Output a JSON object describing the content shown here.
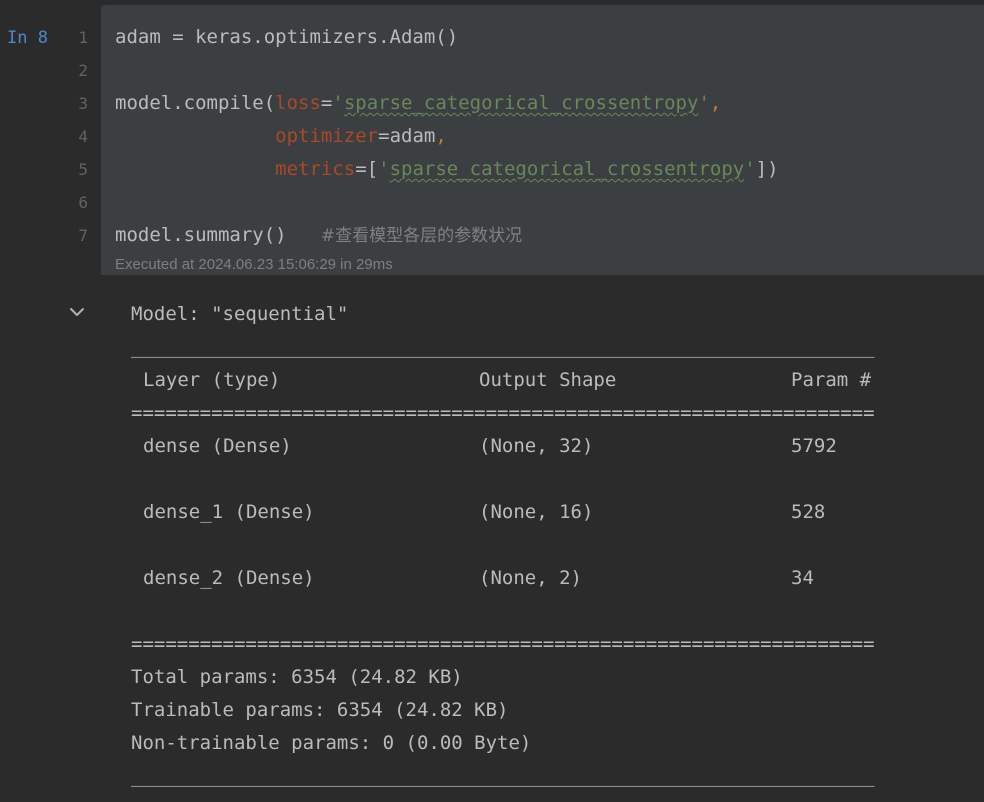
{
  "cell": {
    "label": "In 8",
    "line_numbers": [
      "1",
      "2",
      "3",
      "4",
      "5",
      "6",
      "7"
    ],
    "code": {
      "line1": "adam = keras.optimizers.Adam()",
      "line3_prefix": "model.compile(",
      "line3_param": "loss",
      "line3_eq": "=",
      "line3_string_open": "'",
      "line3_string_body": "sparse_categorical_crossentropy",
      "line3_string_close": "'",
      "line3_comma": ",",
      "line4_indent": "              ",
      "line4_param": "optimizer",
      "line4_eq": "=",
      "line4_value": "adam",
      "line4_comma": ",",
      "line5_indent": "              ",
      "line5_param": "metrics",
      "line5_eq": "=",
      "line5_bracket_open": "[",
      "line5_string_open": "'",
      "line5_string_body": "sparse_categorical_crossentropy",
      "line5_string_close": "'",
      "line5_close": "])",
      "line7_code": "model.summary()",
      "line7_spacing": "   ",
      "line7_comment": "#查看模型各层的参数状况"
    },
    "executed": "Executed at 2024.06.23 15:06:29 in 29ms"
  },
  "output": {
    "model_line": "Model: \"sequential\"",
    "separator_dash": "_________________________________________________________________",
    "separator_eq": "=================================================================",
    "headers": {
      "layer": "Layer (type)",
      "output_shape": "Output Shape",
      "param": "Param #"
    },
    "rows": [
      {
        "layer": "dense (Dense)",
        "shape": "(None, 32)",
        "params": "5792"
      },
      {
        "layer": "dense_1 (Dense)",
        "shape": "(None, 16)",
        "params": "528"
      },
      {
        "layer": "dense_2 (Dense)",
        "shape": "(None, 2)",
        "params": "34"
      }
    ],
    "total": "Total params: 6354 (24.82 KB)",
    "trainable": "Trainable params: 6354 (24.82 KB)",
    "non_trainable": "Non-trainable params: 0 (0.00 Byte)"
  },
  "colors": {
    "background": "#2b2b2b",
    "cell_background": "#3c3f41",
    "code_text": "#bbbbbb",
    "param_keyword": "#aa4926",
    "string": "#6a8759",
    "punctuation": "#cc7832",
    "comment": "#808080",
    "cell_label": "#4e88c9"
  },
  "icons": {
    "collapse": "chevron-down-icon"
  }
}
